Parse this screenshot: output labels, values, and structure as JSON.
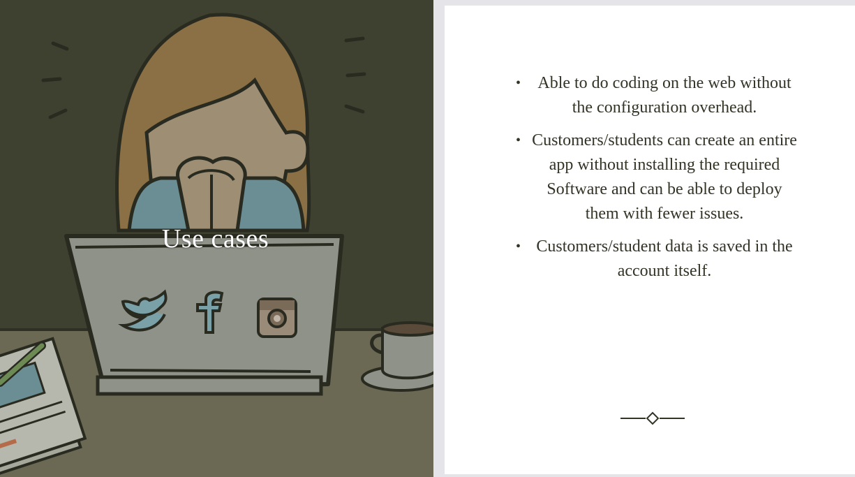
{
  "slide": {
    "title": "Use cases",
    "bullets": [
      "Able to do coding on the web without the configuration overhead.",
      "Customers/students can create an entire app without installing the required Software and can be able to deploy them with fewer issues.",
      "Customers/student data is saved in the account itself."
    ],
    "bullet_glyph": "•"
  },
  "illustration": {
    "description_icons": [
      "twitter-icon",
      "facebook-icon",
      "instagram-icon",
      "coffee-cup-icon"
    ]
  },
  "colors": {
    "left_background": "#3f4130",
    "desk": "#6b6853",
    "text": "#333326",
    "title": "#ffffff"
  }
}
